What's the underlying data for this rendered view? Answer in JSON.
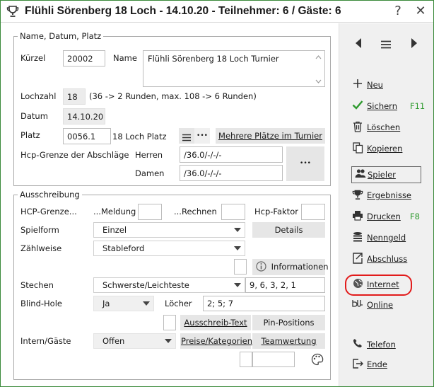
{
  "window": {
    "title": "Flühli Sörenberg 18 Loch - 14.10.20 - Teilnehmer: 6 / Gäste: 6",
    "help_glyph": "?",
    "close_glyph": "✕"
  },
  "section_general": {
    "legend": "Name, Datum, Platz",
    "kuerzel_label": "Kürzel",
    "kuerzel_value": "20002",
    "name_label": "Name",
    "name_value": "Flühli Sörenberg 18 Loch Turnier",
    "lochzahl_label": "Lochzahl",
    "lochzahl_value": "18",
    "lochzahl_hint": "(36 -> 2 Runden, max. 108 -> 6 Runden)",
    "datum_label": "Datum",
    "datum_value": "14.10.20",
    "platz_label": "Platz",
    "platz_value": "0056.1",
    "platz_type": "18 Loch Platz",
    "mehrere_plaetze_button": "Mehrere Plätze im Turnier",
    "hcp_grenze_label": "Hcp-Grenze der Abschläge",
    "herren_label": "Herren",
    "herren_value": "/36.0/-/-/-",
    "damen_label": "Damen",
    "damen_value": "/36.0/-/-/-",
    "more_glyph": "•••"
  },
  "section_ausschreibung": {
    "legend": "Ausschreibung",
    "hcp_grenze_label": "HCP-Grenze...",
    "meldung_label": "...Meldung",
    "rechnen_label": "...Rechnen",
    "hcp_faktor_label": "Hcp-Faktor",
    "spielform_label": "Spielform",
    "spielform_value": "Einzel",
    "details_button": "Details",
    "zaehlweise_label": "Zählweise",
    "zaehlweise_value": "Stableford",
    "informationen_button": "Informationen",
    "stechen_label": "Stechen",
    "stechen_value": "Schwerste/Leichteste",
    "stechen_holes": "9, 6, 3, 2, 1",
    "blind_hole_label": "Blind-Hole",
    "blind_hole_value": "Ja",
    "loecher_label": "Löcher",
    "loecher_value": "2;  5;  7",
    "ausschreib_text_button": "Ausschreib-Text",
    "pin_positions_button": "Pin-Positions",
    "intern_gaeste_label": "Intern/Gäste",
    "intern_gaeste_value": "Offen",
    "preise_button": "Preise/Kategorien",
    "teamwertung_button": "Teamwertung"
  },
  "sidebar": {
    "items": [
      {
        "label": "Neu",
        "icon": "plus-icon",
        "shortcut": ""
      },
      {
        "label": "Sichern",
        "icon": "check-icon",
        "shortcut": "F11"
      },
      {
        "label": "Löschen",
        "icon": "trash-icon",
        "shortcut": ""
      },
      {
        "label": "Kopieren",
        "icon": "copy-icon",
        "shortcut": ""
      },
      {
        "label": "Spieler",
        "icon": "players-icon",
        "shortcut": ""
      },
      {
        "label": "Ergebnisse",
        "icon": "trophy-icon",
        "shortcut": ""
      },
      {
        "label": "Drucken",
        "icon": "printer-icon",
        "shortcut": "F8"
      },
      {
        "label": "Nenngeld",
        "icon": "coins-icon",
        "shortcut": ""
      },
      {
        "label": "Abschluss",
        "icon": "export-icon",
        "shortcut": ""
      },
      {
        "label": "Internet",
        "icon": "globe-icon",
        "shortcut": ""
      },
      {
        "label": "Online",
        "icon": "online-icon",
        "shortcut": ""
      },
      {
        "label": "Telefon",
        "icon": "phone-icon",
        "shortcut": ""
      },
      {
        "label": "Ende",
        "icon": "exit-icon",
        "shortcut": ""
      }
    ]
  },
  "colors": {
    "accent_green": "#2e9a2e",
    "highlight_red": "#e21b1b"
  }
}
